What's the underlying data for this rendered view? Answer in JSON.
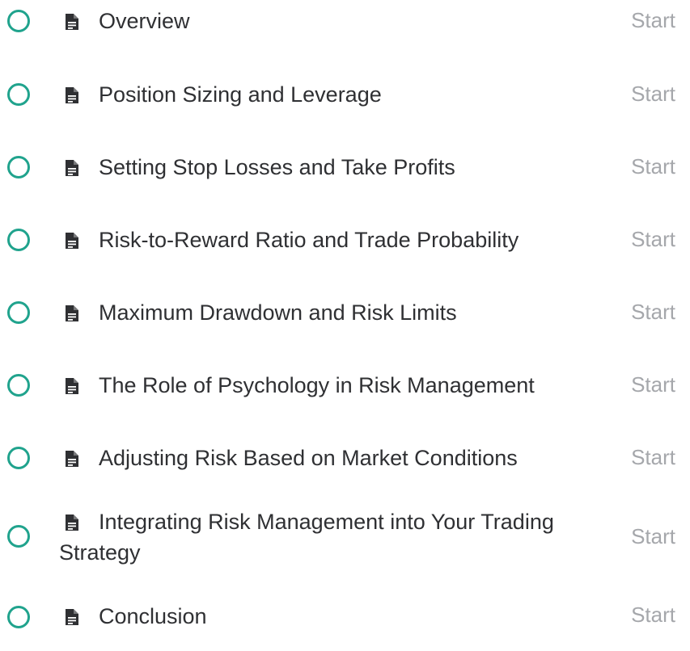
{
  "lessons": [
    {
      "title": "Overview",
      "status_icon": "circle-empty-icon",
      "type_icon": "document-icon",
      "action": "Start"
    },
    {
      "title": "Position Sizing and Leverage",
      "status_icon": "circle-empty-icon",
      "type_icon": "document-icon",
      "action": "Start"
    },
    {
      "title": "Setting Stop Losses and Take Profits",
      "status_icon": "circle-empty-icon",
      "type_icon": "document-icon",
      "action": "Start"
    },
    {
      "title": "Risk-to-Reward Ratio and Trade Probability",
      "status_icon": "circle-empty-icon",
      "type_icon": "document-icon",
      "action": "Start"
    },
    {
      "title": "Maximum Drawdown and Risk Limits",
      "status_icon": "circle-empty-icon",
      "type_icon": "document-icon",
      "action": "Start"
    },
    {
      "title": "The Role of Psychology in Risk Management",
      "status_icon": "circle-empty-icon",
      "type_icon": "document-icon",
      "action": "Start"
    },
    {
      "title": "Adjusting Risk Based on Market Conditions",
      "status_icon": "circle-empty-icon",
      "type_icon": "document-icon",
      "action": "Start"
    },
    {
      "title": "Integrating Risk Management into Your Trading Strategy",
      "status_icon": "circle-empty-icon",
      "type_icon": "document-icon",
      "action": "Start"
    },
    {
      "title": "Conclusion",
      "status_icon": "circle-empty-icon",
      "type_icon": "document-icon",
      "action": "Start"
    }
  ],
  "colors": {
    "accent": "#20a38d",
    "title_text": "#2f3033",
    "action_text": "#a5a7ab",
    "icon": "#2f3033"
  }
}
